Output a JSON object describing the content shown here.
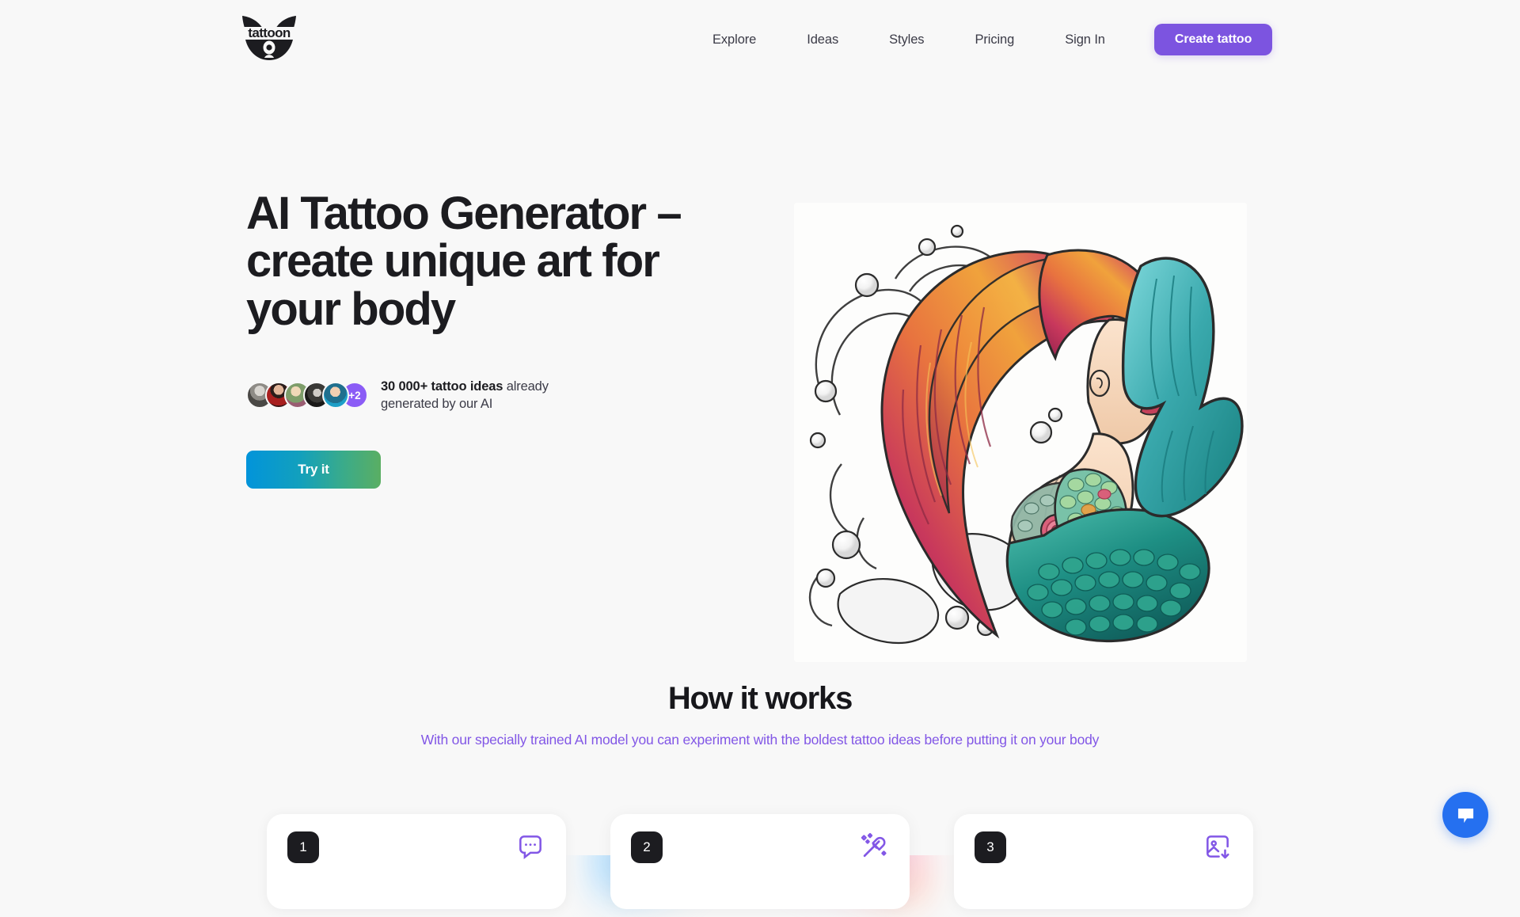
{
  "brand": {
    "name": "tattoon",
    "logo_icon": "raccoon-face-logo"
  },
  "header": {
    "nav": [
      {
        "label": "Explore"
      },
      {
        "label": "Ideas"
      },
      {
        "label": "Styles"
      },
      {
        "label": "Pricing"
      }
    ],
    "signin_label": "Sign In",
    "cta_label": "Create tattoo",
    "cta_color": "#7c54e0"
  },
  "hero": {
    "title": "AI Tattoo Generator – create unique art for your body",
    "social_proof": {
      "highlight": "30 000+ tattoo ideas",
      "rest": " already generated by our AI",
      "extra_count": "+2",
      "avatar_count": 5
    },
    "cta_label": "Try it",
    "cta_gradient_from": "#0294da",
    "cta_gradient_to": "#5aae63",
    "image_alt": "mermaid-tattoo-illustration"
  },
  "how_it_works": {
    "title": "How it works",
    "subtitle": "With our specially trained AI model you can experiment with the boldest tattoo ideas before putting it on your body",
    "subtitle_color": "#8257e6",
    "cards": [
      {
        "number": "1",
        "icon": "chat-bubble-dots-icon"
      },
      {
        "number": "2",
        "icon": "magic-wand-sparkles-icon"
      },
      {
        "number": "3",
        "icon": "image-download-icon"
      }
    ]
  },
  "chat_widget": {
    "icon": "chat-bubble-icon",
    "color": "#2570f0"
  }
}
